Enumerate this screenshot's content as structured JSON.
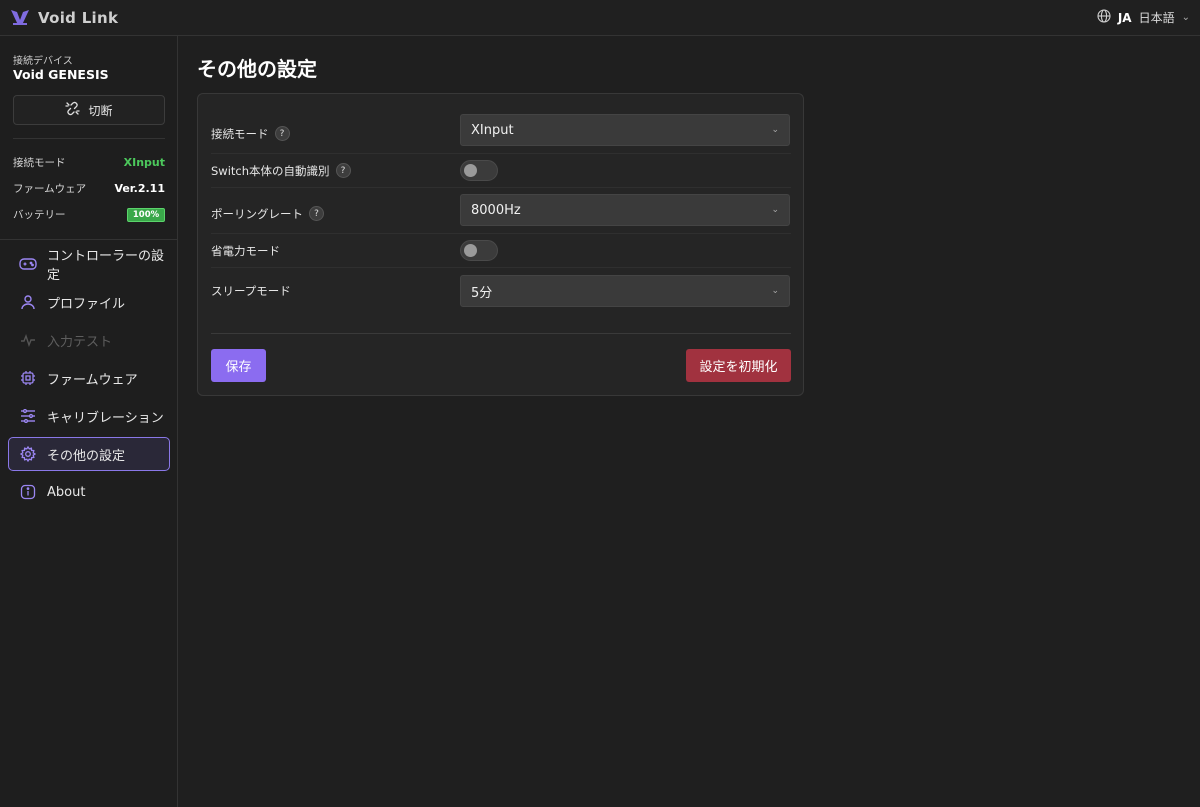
{
  "app": {
    "title": "Void Link",
    "language_code": "JA",
    "language_name": "日本語"
  },
  "sidebar": {
    "device_label": "接続デバイス",
    "device_name": "Void GENESIS",
    "disconnect_label": "切断",
    "info": [
      {
        "key": "接続モード",
        "value": "XInput"
      },
      {
        "key": "ファームウェア",
        "value": "Ver.2.11"
      },
      {
        "key": "バッテリー",
        "value": "100%"
      }
    ],
    "battery_level": 1.0,
    "nav": [
      {
        "label": "コントローラーの設定",
        "icon": "gamepad-icon"
      },
      {
        "label": "プロファイル",
        "icon": "user-icon"
      },
      {
        "label": "入力テスト",
        "icon": "activity-icon",
        "disabled": true
      },
      {
        "label": "ファームウェア",
        "icon": "chip-icon"
      },
      {
        "label": "キャリブレーション",
        "icon": "sliders-icon"
      },
      {
        "label": "その他の設定",
        "icon": "gear-icon",
        "active": true
      },
      {
        "label": "About",
        "icon": "info-icon"
      }
    ]
  },
  "main": {
    "title": "その他の設定",
    "settings": [
      {
        "label": "接続モード",
        "help": "?",
        "type": "select",
        "value": "XInput"
      },
      {
        "label": "Switch本体の自動識別",
        "help": "?",
        "type": "toggle",
        "value": false
      },
      {
        "label": "ポーリングレート",
        "help": "?",
        "type": "select",
        "value": "8000Hz"
      },
      {
        "label": "省電力モード",
        "type": "toggle",
        "value": false
      },
      {
        "label": "スリープモード",
        "type": "select",
        "value": "5分"
      }
    ],
    "save_label": "保存",
    "reset_label": "設定を初期化"
  },
  "colors": {
    "accent": "#8b6cf0",
    "danger": "#a1323f",
    "success": "#4cc85c",
    "background": "#1f1f1f"
  }
}
